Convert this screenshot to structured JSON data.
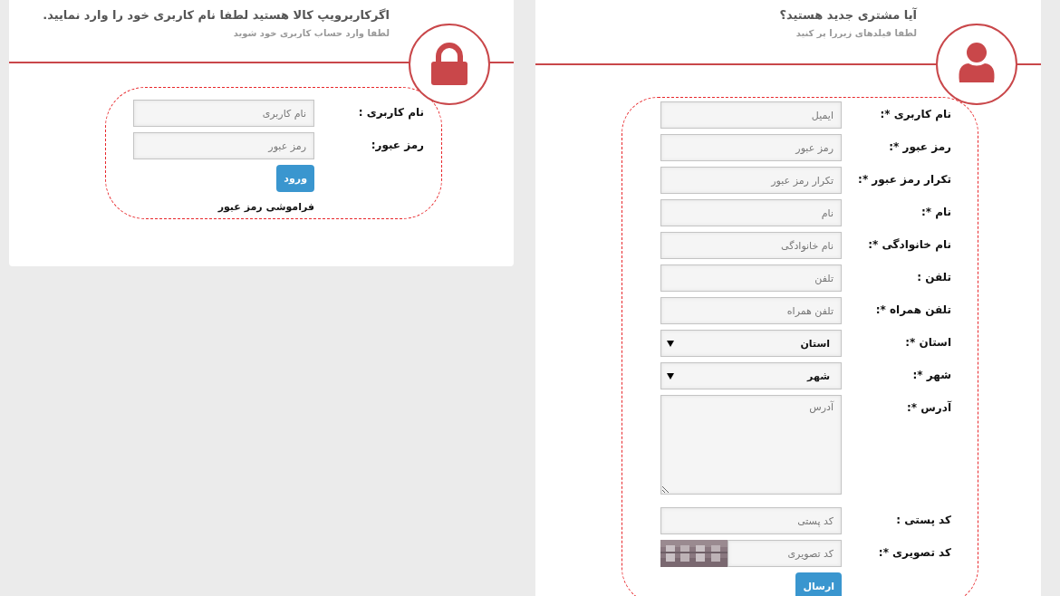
{
  "login": {
    "title": "اگرکاربرویپ کالا هستید لطفا نام کاربری خود را وارد نمایید.",
    "subtitle": "لطفا وارد حساب کاربری خود شوید",
    "fields": [
      {
        "kind": "text",
        "label": "نام کاربری :",
        "placeholder": "نام کاربری"
      },
      {
        "kind": "text",
        "label": "رمز عبور:",
        "placeholder": "رمز عبور"
      }
    ],
    "button": "ورود",
    "forgot_link": "فراموشی رمز عبور"
  },
  "register": {
    "title": "آیا مشتری جدید هستید؟",
    "subtitle": "لطفا فیلدهای زیررا پر کنید",
    "fields": [
      {
        "kind": "text",
        "label": "نام کاربری *:",
        "placeholder": "ایمیل"
      },
      {
        "kind": "text",
        "label": "رمز عبور *:",
        "placeholder": "رمز عبور"
      },
      {
        "kind": "text",
        "label": "تکرار رمز عبور *:",
        "placeholder": "تکرار رمز عبور"
      },
      {
        "kind": "text",
        "label": "نام *:",
        "placeholder": "نام"
      },
      {
        "kind": "text",
        "label": "نام خانوادگی *:",
        "placeholder": "نام خانوادگی"
      },
      {
        "kind": "text",
        "label": "تلفن :",
        "placeholder": "تلفن"
      },
      {
        "kind": "text",
        "label": "تلفن همراه *:",
        "placeholder": "تلفن همراه"
      },
      {
        "kind": "select",
        "label": "استان *:",
        "value": "استان"
      },
      {
        "kind": "select",
        "label": "شهر *:",
        "value": "شهر"
      },
      {
        "kind": "textarea",
        "label": "آدرس *:",
        "placeholder": "آدرس"
      },
      {
        "kind": "text",
        "label": "کد پستی :",
        "placeholder": "کد پستی"
      },
      {
        "kind": "captcha",
        "label": "کد تصویری *:",
        "placeholder": "کد تصویری"
      }
    ],
    "button": "ارسال"
  }
}
